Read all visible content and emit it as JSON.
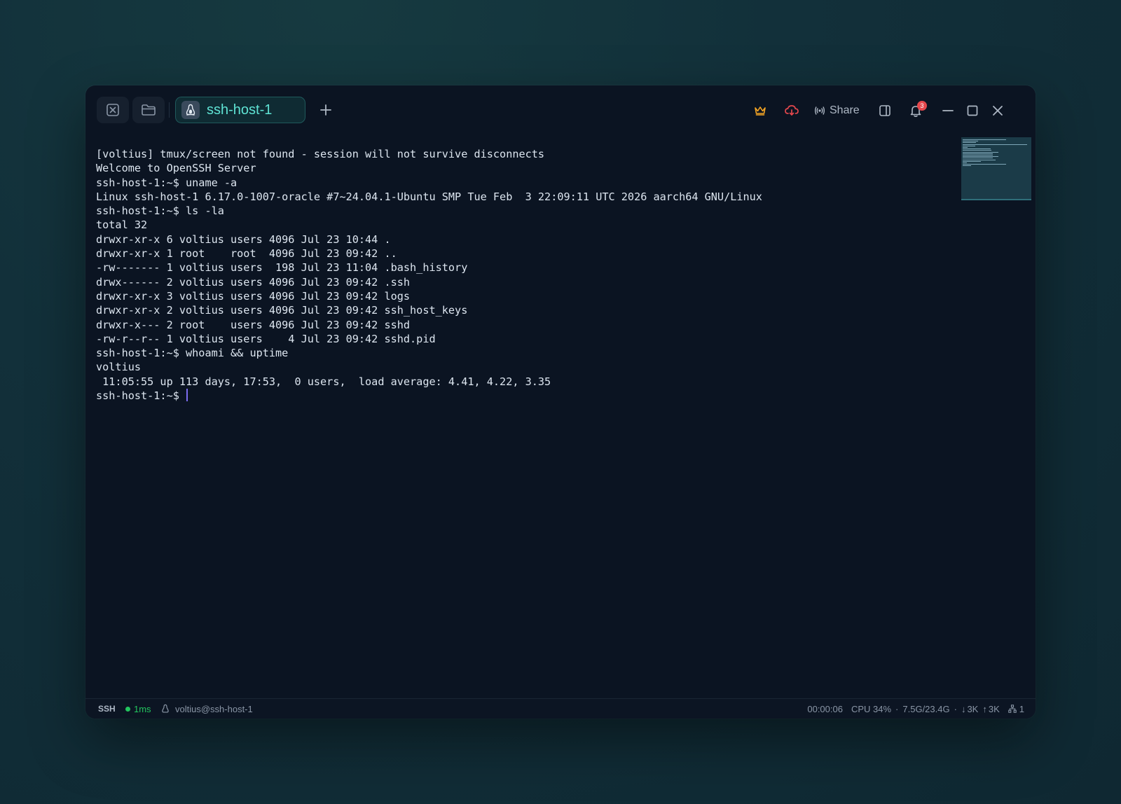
{
  "tab": {
    "label": "ssh-host-1"
  },
  "toolbar": {
    "share_label": "Share",
    "notification_count": "3"
  },
  "terminal": {
    "lines": [
      "[voltius] tmux/screen not found - session will not survive disconnects",
      "Welcome to OpenSSH Server",
      "ssh-host-1:~$ uname -a",
      "Linux ssh-host-1 6.17.0-1007-oracle #7~24.04.1-Ubuntu SMP Tue Feb  3 22:09:11 UTC 2026 aarch64 GNU/Linux",
      "ssh-host-1:~$ ls -la",
      "total 32",
      "drwxr-xr-x 6 voltius users 4096 Jul 23 10:44 .",
      "drwxr-xr-x 1 root    root  4096 Jul 23 09:42 ..",
      "-rw------- 1 voltius users  198 Jul 23 11:04 .bash_history",
      "drwx------ 2 voltius users 4096 Jul 23 09:42 .ssh",
      "drwxr-xr-x 3 voltius users 4096 Jul 23 09:42 logs",
      "drwxr-xr-x 2 voltius users 4096 Jul 23 09:42 ssh_host_keys",
      "drwxr-x--- 2 root    users 4096 Jul 23 09:42 sshd",
      "-rw-r--r-- 1 voltius users    4 Jul 23 09:42 sshd.pid",
      "ssh-host-1:~$ whoami && uptime",
      "voltius",
      " 11:05:55 up 113 days, 17:53,  0 users,  load average: 4.41, 4.22, 3.35"
    ],
    "prompt": "ssh-host-1:~$ "
  },
  "statusbar": {
    "protocol": "SSH",
    "latency": "1ms",
    "user_host": "voltius@ssh-host-1",
    "session_time": "00:00:06",
    "cpu": "CPU 34%",
    "memory": "7.5G/23.4G",
    "net_down": "3K",
    "net_up": "3K",
    "connections": "1"
  },
  "colors": {
    "accent": "#5fe3d4",
    "crown": "#f5a524",
    "cloud_alert": "#e5484d",
    "latency_ok": "#22c55e",
    "cursor": "#7c6cf0"
  }
}
